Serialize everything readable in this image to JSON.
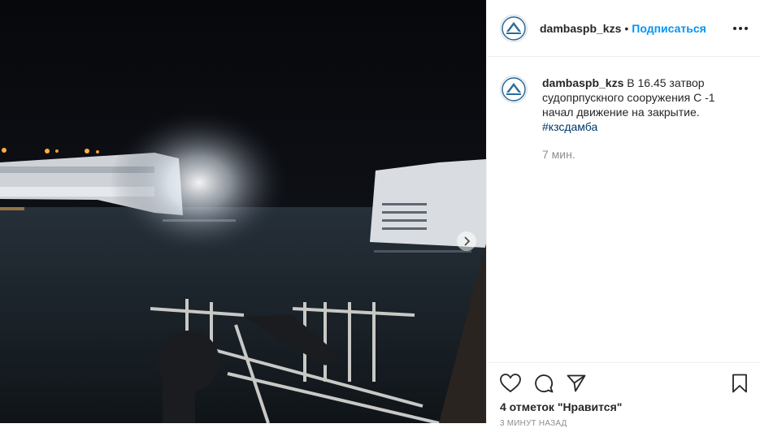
{
  "post": {
    "media": {
      "description_icon": "video-frame"
    },
    "header": {
      "username": "dambaspb_kzs",
      "separator": "•",
      "follow_label": "Подписаться"
    },
    "caption": {
      "username": "dambaspb_kzs",
      "text": "В 16.45 затвор судопрпускного сооружения С -1 начал движение на закрытие.",
      "hashtag": "#кзсдамба",
      "time": "7 мин."
    },
    "actions": {
      "likes_text": "4 отметок \"Нравится\"",
      "ago_text": "3 МИНУТ НАЗАД"
    }
  },
  "colors": {
    "accent": "#0095f6",
    "hashtag": "#00376b",
    "muted": "#8e8e8e"
  }
}
